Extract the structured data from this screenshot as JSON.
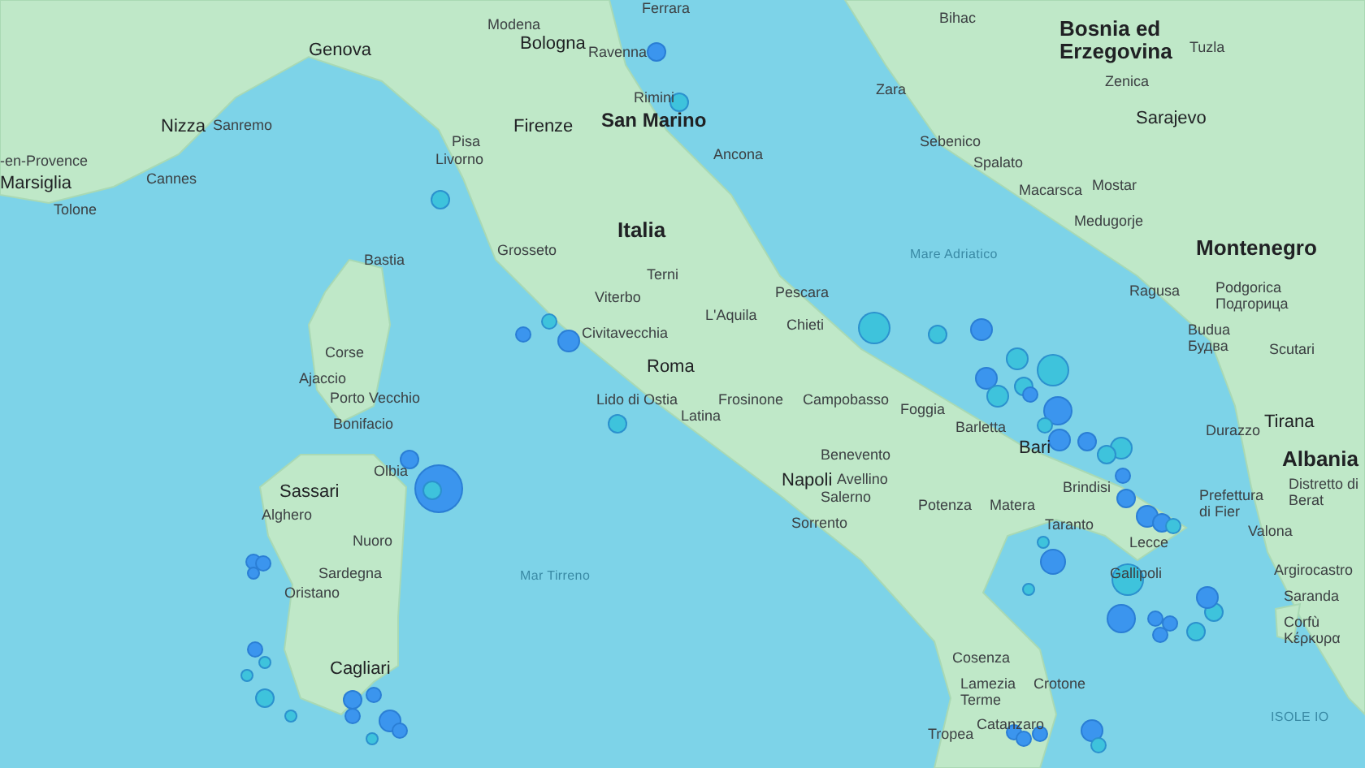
{
  "map": {
    "labels": [
      {
        "kind": "city",
        "text": "Ferrara"
      },
      {
        "kind": "city",
        "text": "Modena"
      },
      {
        "kind": "city",
        "text": "Bihac"
      },
      {
        "kind": "major",
        "text": "Genova"
      },
      {
        "kind": "major",
        "text": "Bologna"
      },
      {
        "kind": "city",
        "text": "Ravenna"
      },
      {
        "kind": "country",
        "text": "Bosnia ed Erzegovina"
      },
      {
        "kind": "city",
        "text": "Tuzla"
      },
      {
        "kind": "city",
        "text": "Rimini"
      },
      {
        "kind": "city",
        "text": "Zara"
      },
      {
        "kind": "city",
        "text": "Zenica"
      },
      {
        "kind": "major",
        "text": "Nizza"
      },
      {
        "kind": "city",
        "text": "Sanremo"
      },
      {
        "kind": "major",
        "text": "Firenze"
      },
      {
        "kind": "region",
        "text": "San Marino"
      },
      {
        "kind": "major",
        "text": "Sarajevo"
      },
      {
        "kind": "city",
        "text": "Pisa"
      },
      {
        "kind": "city",
        "text": "Sebenico"
      },
      {
        "kind": "city",
        "text": "-en-Provence"
      },
      {
        "kind": "city",
        "text": "Livorno"
      },
      {
        "kind": "city",
        "text": "Ancona"
      },
      {
        "kind": "city",
        "text": "Spalato"
      },
      {
        "kind": "major",
        "text": "Marsiglia"
      },
      {
        "kind": "city",
        "text": "Cannes"
      },
      {
        "kind": "city",
        "text": "Macarsca"
      },
      {
        "kind": "city",
        "text": "Mostar"
      },
      {
        "kind": "city",
        "text": "Tolone"
      },
      {
        "kind": "country",
        "text": "Italia"
      },
      {
        "kind": "city",
        "text": "Medugorje"
      },
      {
        "kind": "city",
        "text": "Bastia"
      },
      {
        "kind": "city",
        "text": "Grosseto"
      },
      {
        "kind": "sea",
        "text": "Mare Adriatico"
      },
      {
        "kind": "country",
        "text": "Montenegro"
      },
      {
        "kind": "city",
        "text": "Terni"
      },
      {
        "kind": "city",
        "text": "Viterbo"
      },
      {
        "kind": "city",
        "text": "Pescara"
      },
      {
        "kind": "city",
        "text": "Ragusa"
      },
      {
        "kind": "city",
        "text": "L'Aquila"
      },
      {
        "kind": "city",
        "text": "Podgorica Подгорица"
      },
      {
        "kind": "city",
        "text": "Civitavecchia"
      },
      {
        "kind": "city",
        "text": "Chieti"
      },
      {
        "kind": "city",
        "text": "Corse"
      },
      {
        "kind": "city",
        "text": "Budua Будва"
      },
      {
        "kind": "city",
        "text": "Scutari"
      },
      {
        "kind": "city",
        "text": "Ajaccio"
      },
      {
        "kind": "major",
        "text": "Roma"
      },
      {
        "kind": "city",
        "text": "Porto Vecchio"
      },
      {
        "kind": "city",
        "text": "Lido di Ostia"
      },
      {
        "kind": "city",
        "text": "Frosinone"
      },
      {
        "kind": "city",
        "text": "Campobasso"
      },
      {
        "kind": "city",
        "text": "Bonifacio"
      },
      {
        "kind": "city",
        "text": "Latina"
      },
      {
        "kind": "city",
        "text": "Foggia"
      },
      {
        "kind": "city",
        "text": "Barletta"
      },
      {
        "kind": "city",
        "text": "Durazzo"
      },
      {
        "kind": "major",
        "text": "Tirana"
      },
      {
        "kind": "city",
        "text": "Benevento"
      },
      {
        "kind": "major",
        "text": "Bari"
      },
      {
        "kind": "city",
        "text": "Olbia"
      },
      {
        "kind": "country",
        "text": "Albania"
      },
      {
        "kind": "major",
        "text": "Sassari"
      },
      {
        "kind": "major",
        "text": "Napoli"
      },
      {
        "kind": "city",
        "text": "Avellino"
      },
      {
        "kind": "city",
        "text": "Salerno"
      },
      {
        "kind": "city",
        "text": "Brindisi"
      },
      {
        "kind": "city",
        "text": "Alghero"
      },
      {
        "kind": "city",
        "text": "Potenza"
      },
      {
        "kind": "city",
        "text": "Matera"
      },
      {
        "kind": "city",
        "text": "Sorrento"
      },
      {
        "kind": "city",
        "text": "Taranto"
      },
      {
        "kind": "city",
        "text": "Prefettura di Fier"
      },
      {
        "kind": "city",
        "text": "Distretto di Berat"
      },
      {
        "kind": "city",
        "text": "Nuoro"
      },
      {
        "kind": "city",
        "text": "Lecce"
      },
      {
        "kind": "city",
        "text": "Valona"
      },
      {
        "kind": "city",
        "text": "Sardegna"
      },
      {
        "kind": "sea",
        "text": "Mar Tirreno"
      },
      {
        "kind": "city",
        "text": "Gallipoli"
      },
      {
        "kind": "city",
        "text": "Argirocastro"
      },
      {
        "kind": "city",
        "text": "Oristano"
      },
      {
        "kind": "city",
        "text": "Saranda"
      },
      {
        "kind": "city",
        "text": "Corfù Κέρκυρα"
      },
      {
        "kind": "major",
        "text": "Cagliari"
      },
      {
        "kind": "city",
        "text": "Cosenza"
      },
      {
        "kind": "city",
        "text": "Lamezia Terme"
      },
      {
        "kind": "city",
        "text": "Crotone"
      },
      {
        "kind": "city",
        "text": "Tropea"
      },
      {
        "kind": "city",
        "text": "Catanzaro"
      },
      {
        "kind": "sea",
        "text": "ISOLE IO"
      }
    ],
    "markers": [
      {
        "color": "#3b95ee"
      },
      {
        "color": "#3ec3dc"
      },
      {
        "color": "#3ec3dc"
      },
      {
        "color": "#3b95ee"
      },
      {
        "color": "#3b95ee"
      },
      {
        "color": "#3ec3dc"
      },
      {
        "color": "#3ec3dc"
      },
      {
        "color": "#3b95ee"
      },
      {
        "color": "#3b95ee"
      },
      {
        "color": "#3ec3dc"
      },
      {
        "color": "#3ec3dc"
      },
      {
        "color": "#3ec3dc"
      },
      {
        "color": "#3b95ee"
      },
      {
        "color": "#3ec3dc"
      },
      {
        "color": "#3ec3dc"
      },
      {
        "color": "#3b95ee"
      },
      {
        "color": "#3ec3dc"
      },
      {
        "color": "#3ec3dc"
      },
      {
        "color": "#3b95ee"
      },
      {
        "color": "#3b95ee"
      },
      {
        "color": "#3ec3dc"
      },
      {
        "color": "#3b95ee"
      },
      {
        "color": "#3b95ee"
      },
      {
        "color": "#3ec3dc"
      },
      {
        "color": "#3ec3dc"
      },
      {
        "color": "#3b95ee"
      },
      {
        "color": "#3b95ee"
      },
      {
        "color": "#3b95ee"
      },
      {
        "color": "#3b95ee"
      },
      {
        "color": "#3ec3dc"
      },
      {
        "color": "#3b95ee"
      },
      {
        "color": "#3ec3dc"
      },
      {
        "color": "#3ec3dc"
      },
      {
        "color": "#3ec3dc"
      },
      {
        "color": "#3b95ee"
      },
      {
        "color": "#3b95ee"
      },
      {
        "color": "#3b95ee"
      },
      {
        "color": "#3ec3dc"
      },
      {
        "color": "#3b95ee"
      },
      {
        "color": "#3ec3dc"
      },
      {
        "color": "#3b95ee"
      },
      {
        "color": "#3b95ee"
      },
      {
        "color": "#3b95ee"
      },
      {
        "color": "#3ec3dc"
      },
      {
        "color": "#3b95ee"
      },
      {
        "color": "#3b95ee"
      },
      {
        "color": "#3b95ee"
      },
      {
        "color": "#3b95ee"
      },
      {
        "color": "#3b95ee"
      },
      {
        "color": "#3ec3dc"
      },
      {
        "color": "#3ec3dc"
      },
      {
        "color": "#3b95ee"
      },
      {
        "color": "#3ec3dc"
      },
      {
        "color": "#3ec3dc"
      },
      {
        "color": "#3b95ee"
      },
      {
        "color": "#3b95ee"
      },
      {
        "color": "#3b95ee"
      },
      {
        "color": "#3b95ee"
      },
      {
        "color": "#3b95ee"
      },
      {
        "color": "#3ec3dc"
      }
    ]
  }
}
